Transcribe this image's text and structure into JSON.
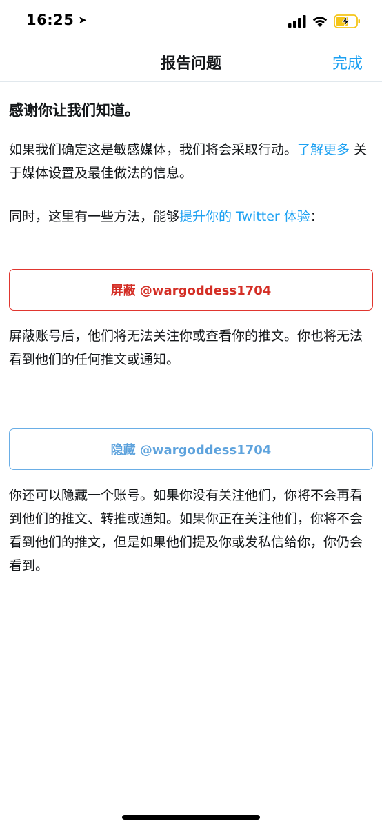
{
  "status_bar": {
    "time": "16:25",
    "location_glyph": "➤"
  },
  "nav": {
    "title": "报告问题",
    "done_label": "完成"
  },
  "content": {
    "thanks_title": "感谢你让我们知道。",
    "p1_text": "如果我们确定这是敏感媒体，我们将会采取行动。",
    "p1_link": "了解更多",
    "p1_tail": " 关于媒体设置及最佳做法的信息。",
    "p2_text": "同时，这里有一些方法，能够",
    "p2_link": "提升你的 Twitter 体验",
    "p2_tail": "：",
    "block_button": "屏蔽 @wargoddess1704",
    "block_desc": "屏蔽账号后，他们将无法关注你或查看你的推文。你也将无法看到他们的任何推文或通知。",
    "mute_button": "隐藏 @wargoddess1704",
    "mute_desc": "你还可以隐藏一个账号。如果你没有关注他们，你将不会再看到他们的推文、转推或通知。如果你正在关注他们，你将不会看到他们的推文，但是如果他们提及你或发私信给你，你仍会看到。"
  },
  "colors": {
    "link_blue": "#1da1f2",
    "block_red": "#d42f26",
    "mute_blue": "#5ea3dd",
    "battery_yellow": "#f5c518"
  }
}
